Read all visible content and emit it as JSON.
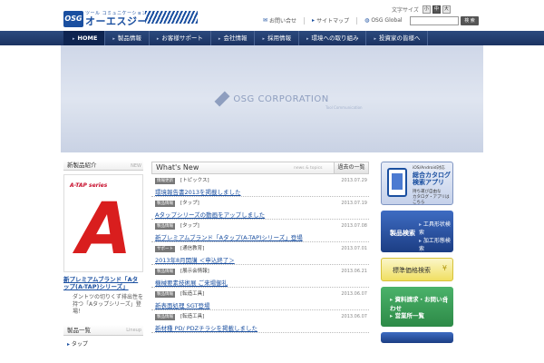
{
  "header": {
    "logo_mark": "OSG",
    "logo_tag": "ツール コミュニケーション",
    "logo_name": "オーエスジー",
    "text_size_label": "文字サイズ",
    "text_sizes": [
      "小",
      "中",
      "大"
    ],
    "utility": {
      "contact": "お問い合せ",
      "sitemap": "サイトマップ",
      "global": "OSG Global"
    },
    "search": {
      "placeholder": "",
      "button": "検 索"
    }
  },
  "nav": {
    "items": [
      "HOME",
      "製品情報",
      "お客様サポート",
      "会社情報",
      "採用情報",
      "環境への取り組み",
      "投資家の皆様へ"
    ]
  },
  "hero": {
    "name": "OSG CORPORATION",
    "sub": "Tool Communication"
  },
  "left": {
    "new_products_title": "新製品紹介",
    "new_badge": "NEW",
    "atap_series": "A-TAP series",
    "atap_letter": "A",
    "atap_title": "新プレミアムブランド「Aタップ(A-TAP)シリーズ」",
    "atap_desc": "ダントツの切りくず排出性を持つ「Aタップシリーズ」登場！",
    "products_title": "製品一覧",
    "lineup_label": "Lineup",
    "products": [
      "タップ"
    ]
  },
  "news": {
    "title": "What's New",
    "subtitle": "news & topics",
    "list_button": "過去の一覧",
    "items": [
      {
        "tag": "情報更新",
        "category": "[トピックス]",
        "date": "2013.07.29",
        "link": "環境報告書2013を掲載しました"
      },
      {
        "tag": "製品情報",
        "category": "[タップ]",
        "date": "2013.07.19",
        "link": "Aタップシリーズの動画をアップしました"
      },
      {
        "tag": "製品情報",
        "category": "[タップ]",
        "date": "2013.07.08",
        "link": "新プレミアムブランド「Aタップ(A-TAP)シリーズ」登場"
      },
      {
        "tag": "サポート",
        "category": "[通信教育]",
        "date": "2013.07.01",
        "link": "2013年8月開講 ＜申込終了＞"
      },
      {
        "tag": "製品情報",
        "category": "[展示会情報]",
        "date": "2013.06.21",
        "link": "機械要素技術展 ご来場御礼"
      },
      {
        "tag": "製品情報",
        "category": "[転造工具]",
        "date": "2013.06.07",
        "link": "新表面処理 SGT登場"
      },
      {
        "tag": "製品情報",
        "category": "[転造工具]",
        "date": "2013.06.07",
        "link": "新材種 PD/ PDZチラシを掲載しました"
      }
    ]
  },
  "right": {
    "catalog": {
      "small": "iOS/Android対応",
      "big_line1": "総合カタログ",
      "big_line2": "検索アプリ",
      "desc_line1": "持ち運び自由な",
      "desc_line2": "カタログ・アプリはこちら"
    },
    "product_search": {
      "label": "製品検索",
      "option1": "工具形状検索",
      "option2": "加工形態検索"
    },
    "price_search": {
      "label": "標準価格検索",
      "icon": "¥"
    },
    "contact": {
      "item1": "資料請求・お問い合わせ",
      "item2": "営業所一覧",
      "icon": "i"
    }
  }
}
